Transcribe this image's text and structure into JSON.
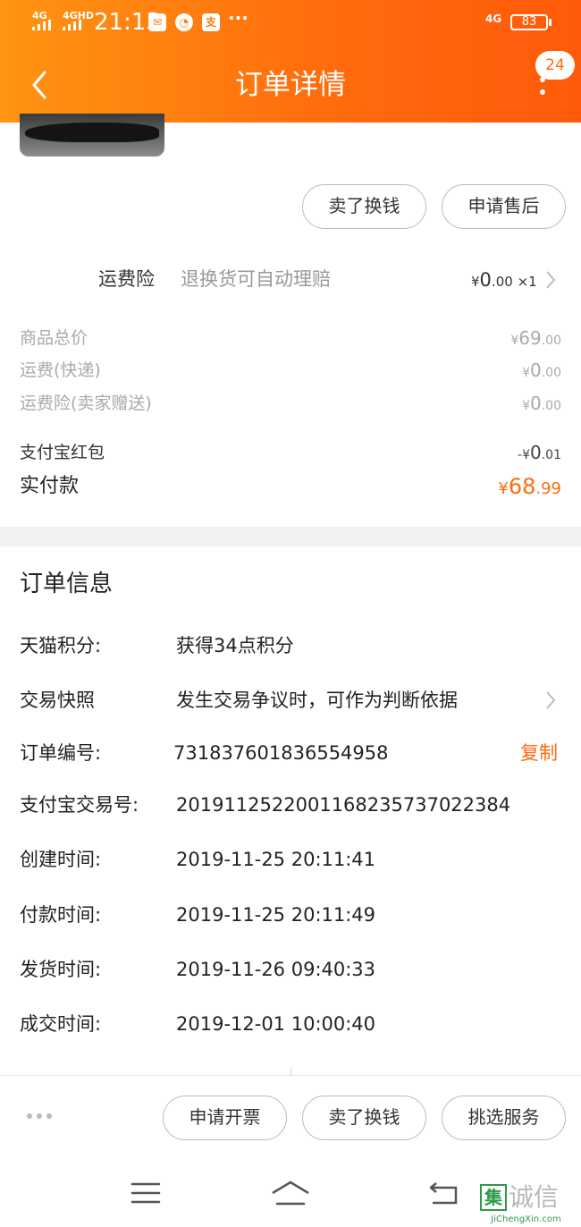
{
  "status_bar": {
    "signal1": "4G",
    "signal2": "4GHD",
    "time": "21:13",
    "dots": "···",
    "net": "4G",
    "battery": "83"
  },
  "header": {
    "title": "订单详情",
    "badge": "24"
  },
  "product": {
    "sell_button": "卖了换钱",
    "after_sale_button": "申请售后"
  },
  "shipping_insurance": {
    "label": "运费险",
    "desc": "退换货可自动理赔",
    "currency": "¥",
    "price_int": "0",
    "price_dec": ".00",
    "qty": "×1"
  },
  "price_summary": {
    "rows": [
      {
        "label": "商品总价",
        "currency": "¥",
        "int": "69",
        "dec": ".00"
      },
      {
        "label": "运费(快递)",
        "currency": "¥",
        "int": "0",
        "dec": ".00"
      },
      {
        "label": "运费险(卖家赠送)",
        "currency": "¥",
        "int": "0",
        "dec": ".00"
      }
    ],
    "redpacket": {
      "label": "支付宝红包",
      "prefix": "-¥",
      "int": "0",
      "dec": ".01"
    },
    "paid": {
      "label": "实付款",
      "currency": "¥",
      "int": "68",
      "dec": ".99"
    }
  },
  "order_info": {
    "title": "订单信息",
    "points": {
      "label": "天猫积分:",
      "value": "获得34点积分"
    },
    "snapshot": {
      "label": "交易快照",
      "value": "发生交易争议时，可作为判断依据"
    },
    "order_no": {
      "label": "订单编号:",
      "value": "731837601836554958",
      "copy": "复制"
    },
    "alipay_no": {
      "label": "支付宝交易号:",
      "value": "2019112522001168235737022384"
    },
    "created": {
      "label": "创建时间:",
      "value": "2019-11-25 20:11:41"
    },
    "paid_time": {
      "label": "付款时间:",
      "value": "2019-11-25 20:11:49"
    },
    "shipped": {
      "label": "发货时间:",
      "value": "2019-11-26 09:40:33"
    },
    "closed": {
      "label": "成交时间:",
      "value": "2019-12-01 10:00:40"
    }
  },
  "action_bar": {
    "invoice": "申请开票",
    "sell": "卖了换钱",
    "services": "挑选服务"
  },
  "watermark": {
    "glyph": "集",
    "text": "诚信",
    "sub": "JiChengXin.com"
  },
  "colors": {
    "accent": "#ff6a0c",
    "header_start": "#ff9412"
  }
}
